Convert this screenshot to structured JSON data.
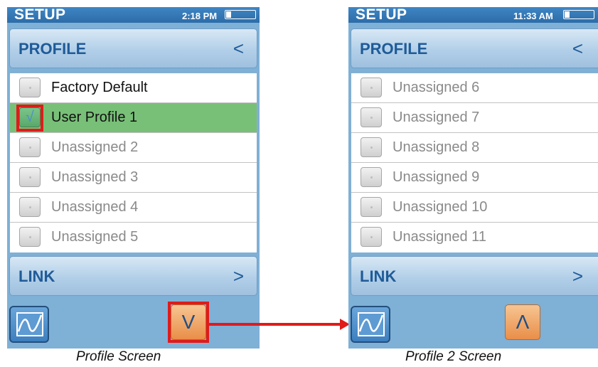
{
  "screens": [
    {
      "status": {
        "title": "SETUP",
        "time": "2:18 PM"
      },
      "profile_bar": {
        "label": "PROFILE",
        "arrow": "<"
      },
      "rows": [
        {
          "label": "Factory Default",
          "state": "assigned"
        },
        {
          "label": "User Profile 1",
          "state": "selected"
        },
        {
          "label": "Unassigned 2",
          "state": "unassigned"
        },
        {
          "label": "Unassigned 3",
          "state": "unassigned"
        },
        {
          "label": "Unassigned 4",
          "state": "unassigned"
        },
        {
          "label": "Unassigned 5",
          "state": "unassigned"
        }
      ],
      "check_glyph": "√",
      "link_bar": {
        "label": "LINK",
        "arrow": ">"
      },
      "page_button": "V",
      "caption": "Profile Screen"
    },
    {
      "status": {
        "title": "SETUP",
        "time": "11:33 AM"
      },
      "profile_bar": {
        "label": "PROFILE",
        "arrow": "<"
      },
      "rows": [
        {
          "label": "Unassigned 6",
          "state": "unassigned"
        },
        {
          "label": "Unassigned 7",
          "state": "unassigned"
        },
        {
          "label": "Unassigned 8",
          "state": "unassigned"
        },
        {
          "label": "Unassigned 9",
          "state": "unassigned"
        },
        {
          "label": "Unassigned 10",
          "state": "unassigned"
        },
        {
          "label": "Unassigned 11",
          "state": "unassigned"
        }
      ],
      "link_bar": {
        "label": "LINK",
        "arrow": ">"
      },
      "page_button": "Λ",
      "caption": "Profile 2 Screen"
    }
  ],
  "icons": {
    "graph_button": "graph-icon",
    "battery": "battery-icon"
  },
  "colors": {
    "status_bar": "#3f86c4",
    "screen_background": "#7fb0d6",
    "selected_row": "#78c077",
    "page_button": "#e98e48",
    "highlight": "#e11a1a",
    "label_blue": "#1f5b98"
  }
}
